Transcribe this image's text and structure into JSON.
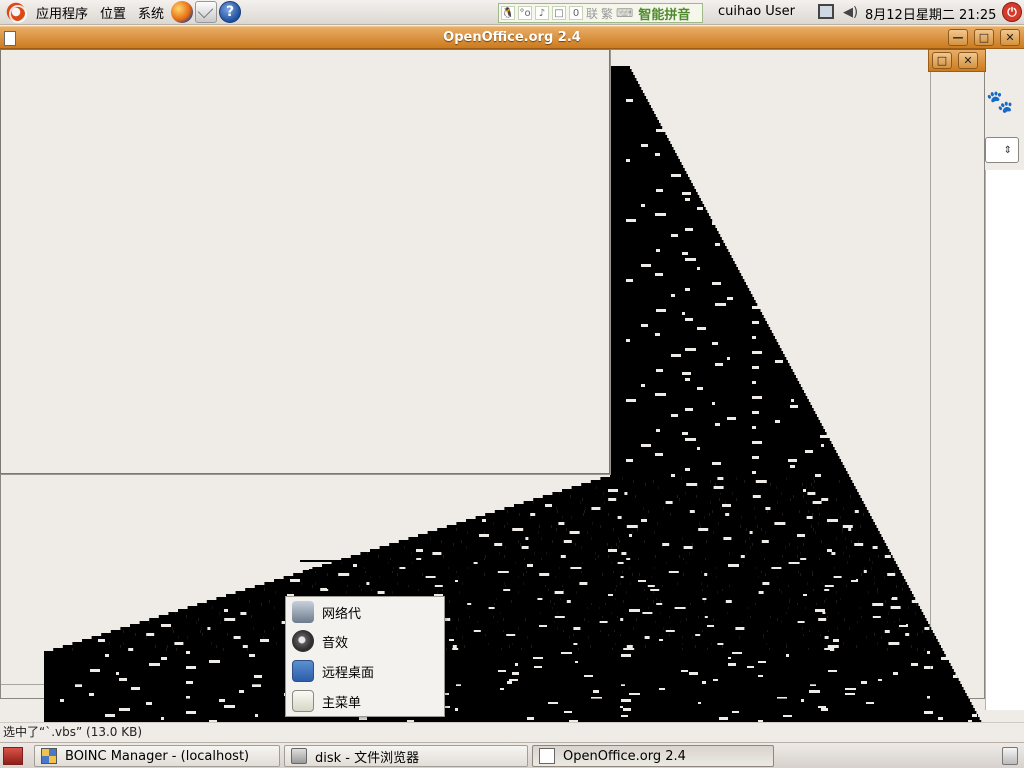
{
  "top_panel": {
    "menu": [
      "应用程序",
      "位置",
      "系统"
    ],
    "launchers": [
      "firefox-icon",
      "mail-icon",
      "help-icon"
    ],
    "help_glyph": "?",
    "ime": {
      "icons": [
        "🐧",
        "°o",
        "♪",
        "□",
        "0"
      ],
      "words": [
        "联",
        "繁",
        "⌨"
      ],
      "name": "智能拼音"
    },
    "user": "cuihao User",
    "volume_glyph": "◀)",
    "clock": "8月12日星期二  21:25",
    "power_glyph": "⏻"
  },
  "main_window": {
    "title": "OpenOffice.org 2.4",
    "buttons": {
      "minimize": "—",
      "maximize": "□",
      "close": "✕"
    }
  },
  "background_window": {
    "buttons": {
      "maximize": "□",
      "close": "✕"
    },
    "gimp_glyph": "🐾",
    "spin_glyph": "⇕"
  },
  "context_menu": {
    "items": [
      {
        "label": "网络代",
        "icon": "network-icon"
      },
      {
        "label": "音效",
        "icon": "sound-icon"
      },
      {
        "label": "远程桌面",
        "icon": "remote-desktop-icon"
      },
      {
        "label": "主菜单",
        "icon": "main-menu-icon"
      }
    ]
  },
  "statusbar": {
    "text": "选中了“`.vbs” (13.0 KB)"
  },
  "taskbar": {
    "tasks": [
      {
        "label": "BOINC Manager - (localhost)",
        "icon": "boinc-icon",
        "active": false
      },
      {
        "label": "disk - 文件浏览器",
        "icon": "disk-icon",
        "active": false
      },
      {
        "label": "OpenOffice.org 2.4",
        "icon": "document-icon",
        "active": true
      }
    ]
  }
}
